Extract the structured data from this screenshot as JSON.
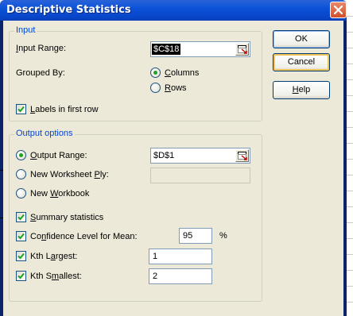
{
  "window": {
    "title": "Descriptive Statistics"
  },
  "input_group": {
    "label": "Input",
    "input_range_label": "Input Range:",
    "input_range_value": "$C$18",
    "grouped_by_label": "Grouped By:",
    "grouped_by_options": [
      "Columns",
      "Rows"
    ],
    "grouped_by_selected": "Columns",
    "labels_first_row_label": "Labels in first row",
    "labels_first_row_checked": true
  },
  "output_group": {
    "label": "Output options",
    "output_range_label": "Output Range:",
    "output_range_value": "$D$1",
    "new_worksheet_label": "New Worksheet Ply:",
    "new_worksheet_value": "",
    "new_workbook_label": "New Workbook",
    "selected_output": "Output Range",
    "summary_statistics_label": "Summary statistics",
    "summary_statistics_checked": true,
    "confidence_label": "Confidence Level for Mean:",
    "confidence_checked": true,
    "confidence_value": "95",
    "confidence_unit": "%",
    "kth_largest_label": "Kth Largest:",
    "kth_largest_checked": true,
    "kth_largest_value": "1",
    "kth_smallest_label": "Kth Smallest:",
    "kth_smallest_checked": true,
    "kth_smallest_value": "2"
  },
  "buttons": {
    "ok": "OK",
    "cancel": "Cancel",
    "help": "Help"
  },
  "colors": {
    "title_bar": "#0b52d8",
    "group_label": "#0046d5",
    "dialog_face": "#ece9d8",
    "radio_dot": "#21a121"
  },
  "icons": {
    "close": "close-icon",
    "range_picker": "range-picker-icon",
    "checkmark": "checkmark-icon"
  }
}
